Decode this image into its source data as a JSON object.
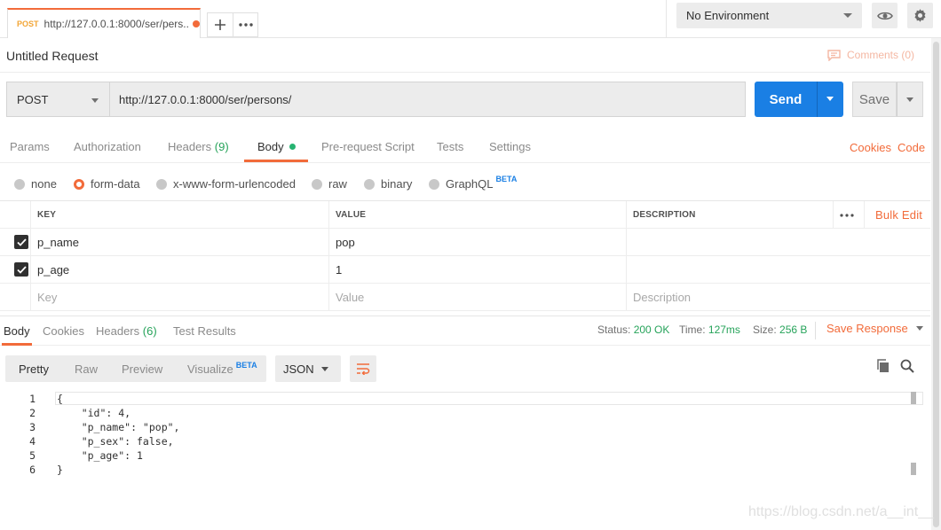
{
  "tab": {
    "method": "POST",
    "url": "http://127.0.0.1:8000/ser/pers..."
  },
  "environment": {
    "selected": "No Environment"
  },
  "request": {
    "title": "Untitled Request",
    "comments": "Comments (0)",
    "method": "POST",
    "url": "http://127.0.0.1:8000/ser/persons/",
    "send": "Send",
    "save": "Save"
  },
  "request_tabs": [
    {
      "label": "Params",
      "count": ""
    },
    {
      "label": "Authorization",
      "count": ""
    },
    {
      "label": "Headers",
      "count": "(9)"
    },
    {
      "label": "Body",
      "count": ""
    },
    {
      "label": "Pre-request Script",
      "count": ""
    },
    {
      "label": "Tests",
      "count": ""
    },
    {
      "label": "Settings",
      "count": ""
    }
  ],
  "request_links": {
    "cookies": "Cookies",
    "code": "Code"
  },
  "body_types": [
    {
      "label": "none",
      "selected": false
    },
    {
      "label": "form-data",
      "selected": true
    },
    {
      "label": "x-www-form-urlencoded",
      "selected": false
    },
    {
      "label": "raw",
      "selected": false
    },
    {
      "label": "binary",
      "selected": false
    },
    {
      "label": "GraphQL",
      "selected": false,
      "badge": "BETA"
    }
  ],
  "kv_table": {
    "headers": {
      "key": "KEY",
      "value": "VALUE",
      "description": "DESCRIPTION",
      "bulk_edit": "Bulk Edit"
    },
    "rows": [
      {
        "checked": true,
        "key": "p_name",
        "value": "pop",
        "description": ""
      },
      {
        "checked": true,
        "key": "p_age",
        "value": "1",
        "description": ""
      }
    ],
    "placeholders": {
      "key": "Key",
      "value": "Value",
      "description": "Description"
    }
  },
  "response_tabs": [
    {
      "label": "Body",
      "count": ""
    },
    {
      "label": "Cookies",
      "count": ""
    },
    {
      "label": "Headers",
      "count": "(6)"
    },
    {
      "label": "Test Results",
      "count": ""
    }
  ],
  "response_status": {
    "status_label": "Status:",
    "status": "200 OK",
    "time_label": "Time:",
    "time": "127ms",
    "size_label": "Size:",
    "size": "256 B",
    "save_response": "Save Response"
  },
  "view_modes": {
    "pretty": "Pretty",
    "raw": "Raw",
    "preview": "Preview",
    "visualize": "Visualize",
    "visualize_badge": "BETA"
  },
  "format": "JSON",
  "code_lines": [
    {
      "n": "1",
      "text": "{"
    },
    {
      "n": "2",
      "text": "    \"id\": 4,"
    },
    {
      "n": "3",
      "text": "    \"p_name\": \"pop\","
    },
    {
      "n": "4",
      "text": "    \"p_sex\": false,"
    },
    {
      "n": "5",
      "text": "    \"p_age\": 1"
    },
    {
      "n": "6",
      "text": "}"
    }
  ],
  "watermark": "https://blog.csdn.net/a__int__",
  "colors": {
    "accent": "#f26b3a",
    "send": "#1a7fe4",
    "success": "#26a35a",
    "beta": "#1a7fe4"
  }
}
